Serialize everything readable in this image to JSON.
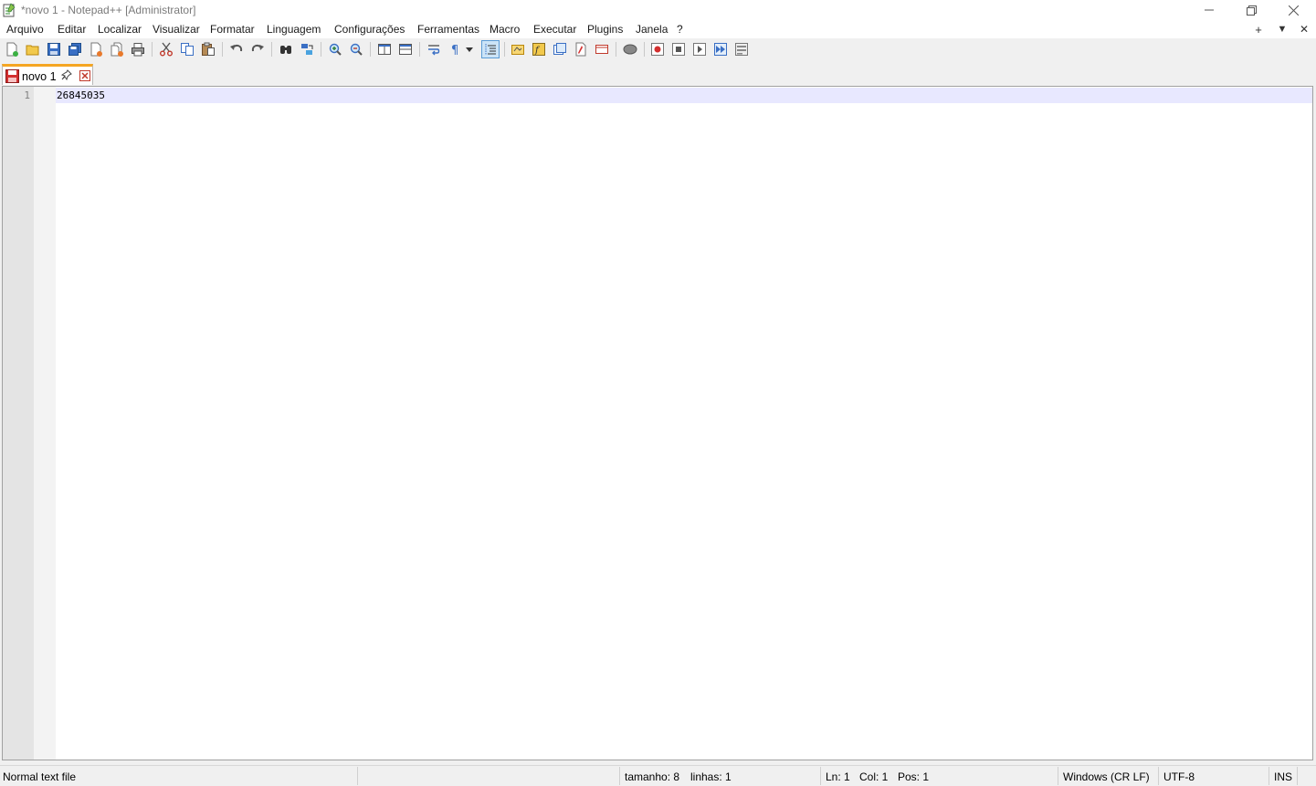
{
  "window": {
    "title": "*novo 1 - Notepad++ [Administrator]",
    "minimize_label": "—",
    "restore_label": "❐",
    "close_label": "✕"
  },
  "menu": {
    "items": [
      "Arquivo",
      "Editar",
      "Localizar",
      "Visualizar",
      "Formatar",
      "Linguagem",
      "Configurações",
      "Ferramentas",
      "Macro",
      "Executar",
      "Plugins",
      "Janela",
      "?"
    ],
    "right_buttons": [
      "+",
      "▼",
      "✕"
    ]
  },
  "toolbar": {
    "icons": [
      "new-file",
      "open-file",
      "save",
      "save-all",
      "close",
      "close-all",
      "print",
      "cut",
      "copy",
      "paste",
      "undo",
      "redo",
      "find",
      "replace",
      "zoom-in",
      "zoom-out",
      "sync-vertical",
      "sync-horizontal",
      "word-wrap",
      "show-all-characters",
      "indent-guide",
      "document-map",
      "function-list",
      "folder-workspace",
      "monitoring",
      "user-defined-language",
      "start-recording",
      "stop-recording",
      "playback",
      "run-macro-multiple",
      "save-macro"
    ]
  },
  "tabs": [
    {
      "label": "novo 1",
      "modified": true,
      "active": true
    }
  ],
  "editor": {
    "lines": [
      {
        "number": "1",
        "text": "26845035"
      }
    ]
  },
  "status": {
    "file_type": "Normal text file",
    "length": "tamanho: 8",
    "lines": "linhas: 1",
    "ln": "Ln: 1",
    "col": "Col: 1",
    "pos": "Pos: 1",
    "eol": "Windows (CR LF)",
    "encoding": "UTF-8",
    "mode": "INS"
  },
  "colors": {
    "tab_accent": "#f5a623",
    "current_line": "#e8e8ff",
    "line_number_margin": "#e4e4e4"
  }
}
